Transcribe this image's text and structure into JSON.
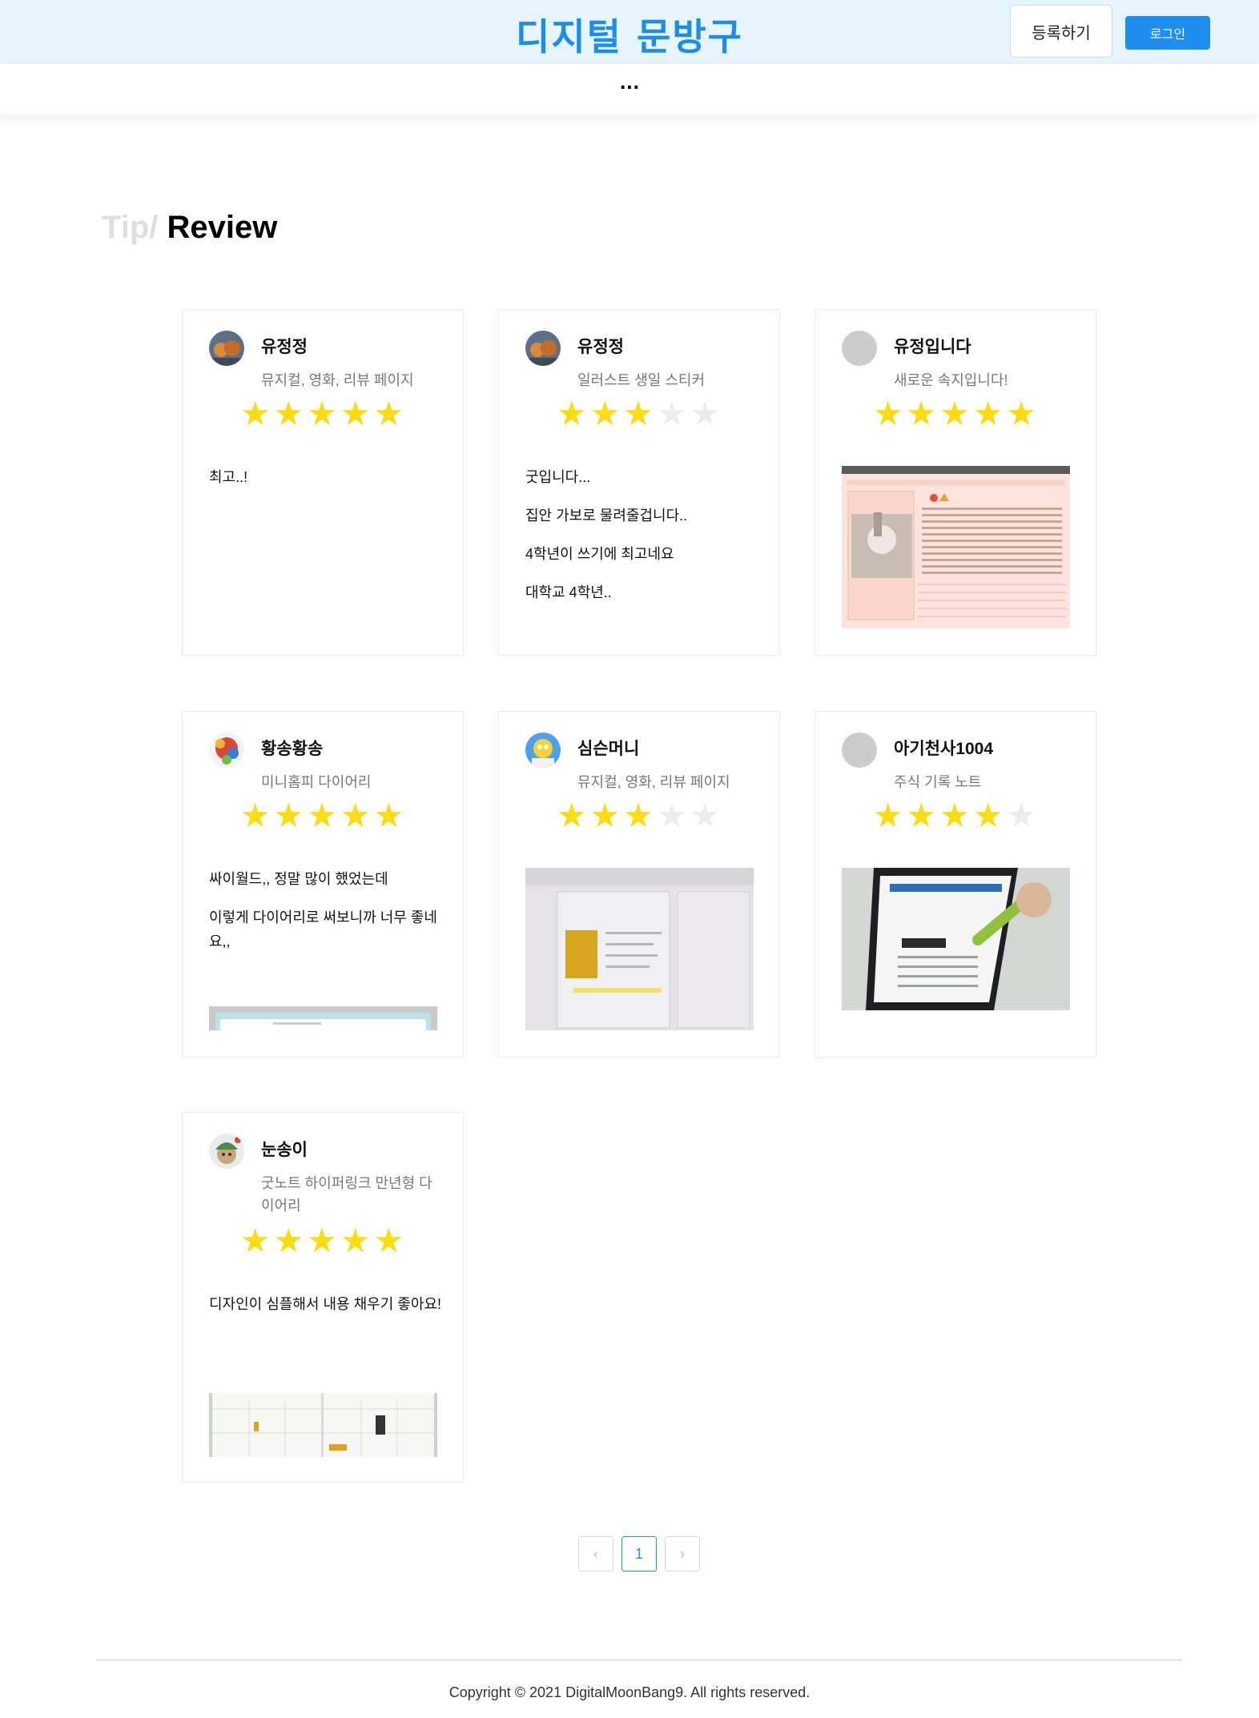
{
  "header": {
    "brand": "디지털 문방구",
    "register_label": "등록하기",
    "login_label": "로그인",
    "more_label": "..."
  },
  "heading": {
    "tip": "Tip",
    "slash": "/",
    "review": "Review"
  },
  "reviews": [
    {
      "user": "유정정",
      "product": "뮤지컬, 영화, 리뷰 페이지",
      "rating": 5,
      "lines": [
        "최고..!"
      ],
      "avatar": "photo-orange"
    },
    {
      "user": "유정정",
      "product": "일러스트 생일 스티커",
      "rating": 3,
      "lines": [
        "굿입니다...",
        "집안 가보로 물려줄겁니다..",
        "4학년이 쓰기에 최고네요",
        "대학교 4학년.."
      ],
      "avatar": "photo-orange"
    },
    {
      "user": "유정입니다",
      "product": "새로운 속지입니다!",
      "rating": 5,
      "lines": [],
      "avatar": "default-grey",
      "image": "pink-diary-page"
    },
    {
      "user": "황송황송",
      "product": "미니홈피 다이어리",
      "rating": 5,
      "lines": [
        "싸이월드,, 정말 많이 했었는데",
        "이렇게 다이어리로 써보니까 너무 좋네요,,"
      ],
      "avatar": "photo-colorful",
      "image": "minihompy-screen"
    },
    {
      "user": "심슨머니",
      "product": "뮤지컬, 영화, 리뷰 페이지",
      "rating": 3,
      "lines": [],
      "avatar": "homer-simpson",
      "image": "tablet-review-page"
    },
    {
      "user": "아기천사1004",
      "product": "주식 기록 노트",
      "rating": 4,
      "lines": [],
      "avatar": "default-grey",
      "image": "tablet-2021-stock"
    },
    {
      "user": "눈송이",
      "product": "굿노트 하이퍼링크 만년형 다이어리",
      "rating": 5,
      "lines": [
        "디자인이 심플해서 내용 채우기 좋아요!"
      ],
      "avatar": "snowman-character",
      "image": "calendar-planner"
    }
  ],
  "pagination": {
    "prev": "‹",
    "current": "1",
    "next": "›"
  },
  "footer": {
    "copyright": "Copyright © 2021 DigitalMoonBang9. All rights reserved."
  },
  "colors": {
    "brand": "#1e8ce8",
    "header_bg": "#e6f4fe",
    "star_on": "#fadb14",
    "star_off": "#ececec",
    "login_bg": "#1e8ef0"
  }
}
